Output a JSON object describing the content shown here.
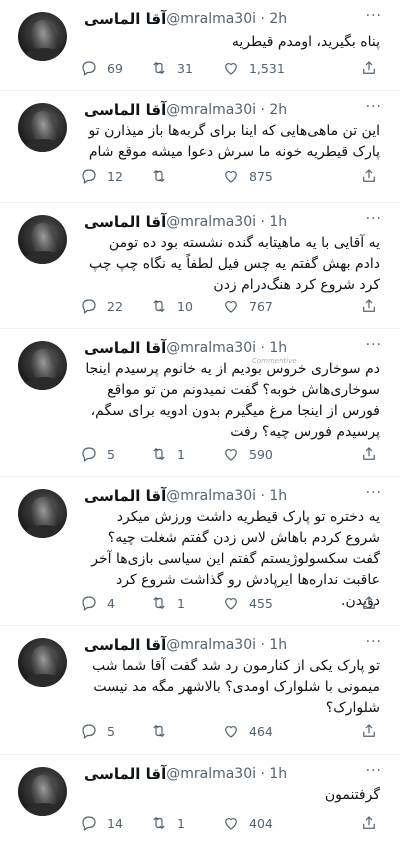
{
  "user": {
    "name": "آقا الماسی",
    "handle": "@mralma30i",
    "more_glyph": "···"
  },
  "watermark": "Commentive",
  "tweets": [
    {
      "time": "2h",
      "text": "پناه بگیرید، اومدم قیطریه",
      "replies": "69",
      "retweets": "31",
      "likes": "1,531"
    },
    {
      "time": "2h",
      "text": "این تن ماهی‌هایی که اینا برای گربه‌ها باز میذارن تو پارک قیطریه خونه ما سرش دعوا میشه موقع شام",
      "replies": "12",
      "retweets": "",
      "likes": "875"
    },
    {
      "time": "1h",
      "text": "یه آقایی با یه ماهیتابه گنده نشسته بود ده تومن دادم بهش گفتم یه چس فیل لطفاً یه نگاه چپ چپ کرد شروع کرد هنگ‌درام زدن",
      "replies": "22",
      "retweets": "10",
      "likes": "767"
    },
    {
      "time": "1h",
      "text": "دم سوخاری خروس بودیم از یه خانوم پرسیدم اینجا سوخاری‌هاش خوبه؟ گفت نمیدونم من تو مواقع فورس از اینجا مرغ میگیرم بدون ادویه برای سگم، پرسیدم فورس چیه؟ رفت",
      "replies": "5",
      "retweets": "1",
      "likes": "590"
    },
    {
      "time": "1h",
      "text": "یه دختره تو پارک قیطریه داشت ورزش میکرد شروع کردم باهاش لاس زدن گفتم شغلت چیه؟ گفت سکسولوژیستم گفتم این سیاسی بازی‌ها آخر عاقبت نداره‌ها ایرپادش رو گذاشت شروع کرد دویدن.",
      "replies": "4",
      "retweets": "1",
      "likes": "455"
    },
    {
      "time": "1h",
      "text": "تو پارک یکی از کنارمون رد شد گفت آقا شما شب میمونی با شلوارک اومدی؟ بالاشهر مگه مد نیست شلوارک؟",
      "replies": "5",
      "retweets": "",
      "likes": "464"
    },
    {
      "time": "1h",
      "text": "گرفتنمون",
      "replies": "14",
      "retweets": "1",
      "likes": "404"
    }
  ],
  "icons": {
    "reply": "reply-icon",
    "retweet": "retweet-icon",
    "like": "heart-icon",
    "share": "share-icon",
    "more": "more-icon"
  },
  "colors": {
    "text": "#0f1419",
    "secondary": "#536471",
    "divider": "#eff3f4"
  }
}
